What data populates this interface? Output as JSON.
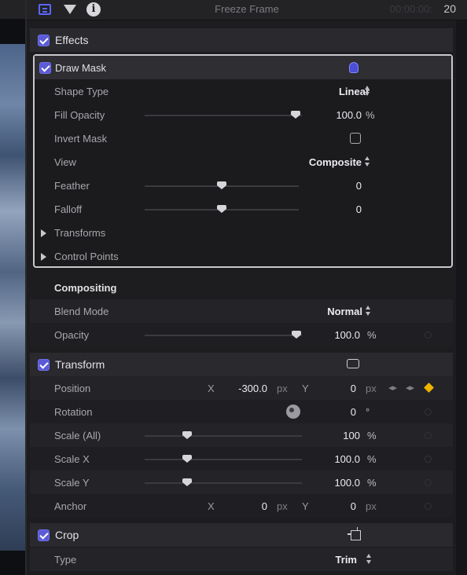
{
  "header": {
    "title": "Freeze Frame",
    "timecode_dim": "00:00:00:",
    "timecode_frames": "20",
    "icons": [
      "video-inspector-icon",
      "filter-icon",
      "info-icon"
    ]
  },
  "effects": {
    "label": "Effects",
    "checked": true
  },
  "draw_mask": {
    "label": "Draw Mask",
    "checked": true,
    "rows": {
      "shape_type": {
        "label": "Shape Type",
        "value": "Linear"
      },
      "fill_opacity": {
        "label": "Fill Opacity",
        "value": "100.0",
        "unit": "%",
        "level": 1.0
      },
      "invert_mask": {
        "label": "Invert Mask",
        "checked": false
      },
      "view": {
        "label": "View",
        "value": "Composite"
      },
      "feather": {
        "label": "Feather",
        "value": "0",
        "level": 0.5
      },
      "falloff": {
        "label": "Falloff",
        "value": "0",
        "level": 0.5
      },
      "transforms": {
        "label": "Transforms"
      },
      "control_points": {
        "label": "Control Points"
      }
    }
  },
  "compositing": {
    "label": "Compositing",
    "blend_mode": {
      "label": "Blend Mode",
      "value": "Normal"
    },
    "opacity": {
      "label": "Opacity",
      "value": "100.0",
      "unit": "%",
      "level": 1.0
    }
  },
  "transform": {
    "label": "Transform",
    "checked": true,
    "position": {
      "label": "Position",
      "x_label": "X",
      "x_value": "-300.0",
      "x_unit": "px",
      "y_label": "Y",
      "y_value": "0",
      "y_unit": "px"
    },
    "rotation": {
      "label": "Rotation",
      "value": "0",
      "unit": "°"
    },
    "scale_all": {
      "label": "Scale (All)",
      "value": "100",
      "unit": "%",
      "level": 0.25
    },
    "scale_x": {
      "label": "Scale X",
      "value": "100.0",
      "unit": "%",
      "level": 0.25
    },
    "scale_y": {
      "label": "Scale Y",
      "value": "100.0",
      "unit": "%",
      "level": 0.25
    },
    "anchor": {
      "label": "Anchor",
      "x_label": "X",
      "x_value": "0",
      "x_unit": "px",
      "y_label": "Y",
      "y_value": "0",
      "y_unit": "px"
    }
  },
  "crop": {
    "label": "Crop",
    "checked": true,
    "type": {
      "label": "Type",
      "value": "Trim"
    }
  },
  "colors": {
    "accent": "#5b5bd6",
    "keyframe": "#f0b400"
  }
}
